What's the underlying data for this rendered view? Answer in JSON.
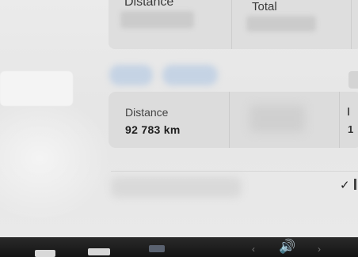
{
  "top_row": {
    "cells": [
      {
        "label": "Distance"
      },
      {
        "label": "Total"
      }
    ]
  },
  "stats": {
    "distance_label": "Distance",
    "distance_value": "92 783 km",
    "third_value_partial": "1"
  },
  "taskbar": {
    "volume_icon": "speaker-volume-icon",
    "chevron_left": "‹",
    "chevron_right": "›",
    "volume_glyph": "🔊"
  },
  "misc": {
    "check_glyph": "✓"
  },
  "colors": {
    "screen_bg": "#e6e6e6",
    "panel_bg": "#dcdcdc",
    "taskbar_bg": "#141414",
    "accent_blurred": "#c5d3e4"
  }
}
